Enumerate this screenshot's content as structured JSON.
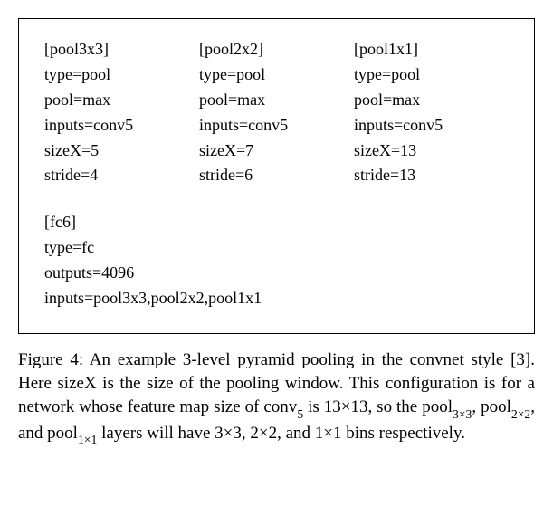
{
  "config": {
    "pools": [
      {
        "header": "[pool3x3]",
        "lines": "type=pool\npool=max\ninputs=conv5\nsizeX=5\nstride=4"
      },
      {
        "header": "[pool2x2]",
        "lines": "type=pool\npool=max\ninputs=conv5\nsizeX=7\nstride=6"
      },
      {
        "header": "[pool1x1]",
        "lines": "type=pool\npool=max\ninputs=conv5\nsizeX=13\nstride=13"
      }
    ],
    "fc": {
      "header": "[fc6]",
      "lines": "type=fc\noutputs=4096\ninputs=pool3x3,pool2x2,pool1x1"
    }
  },
  "caption": {
    "t1": "Figure 4: An example 3-level pyramid pooling in the convnet style [3]. Here sizeX is the size of the pooling window. This configuration is for a network whose feature map size of conv",
    "s1": "5",
    "t2": " is 13×13, so the pool",
    "s2": "3×3",
    "t3": ", pool",
    "s3": "2×2",
    "t4": ", and pool",
    "s4": "1×1",
    "t5": " layers will have 3×3, 2×2, and 1×1 bins respectively."
  }
}
